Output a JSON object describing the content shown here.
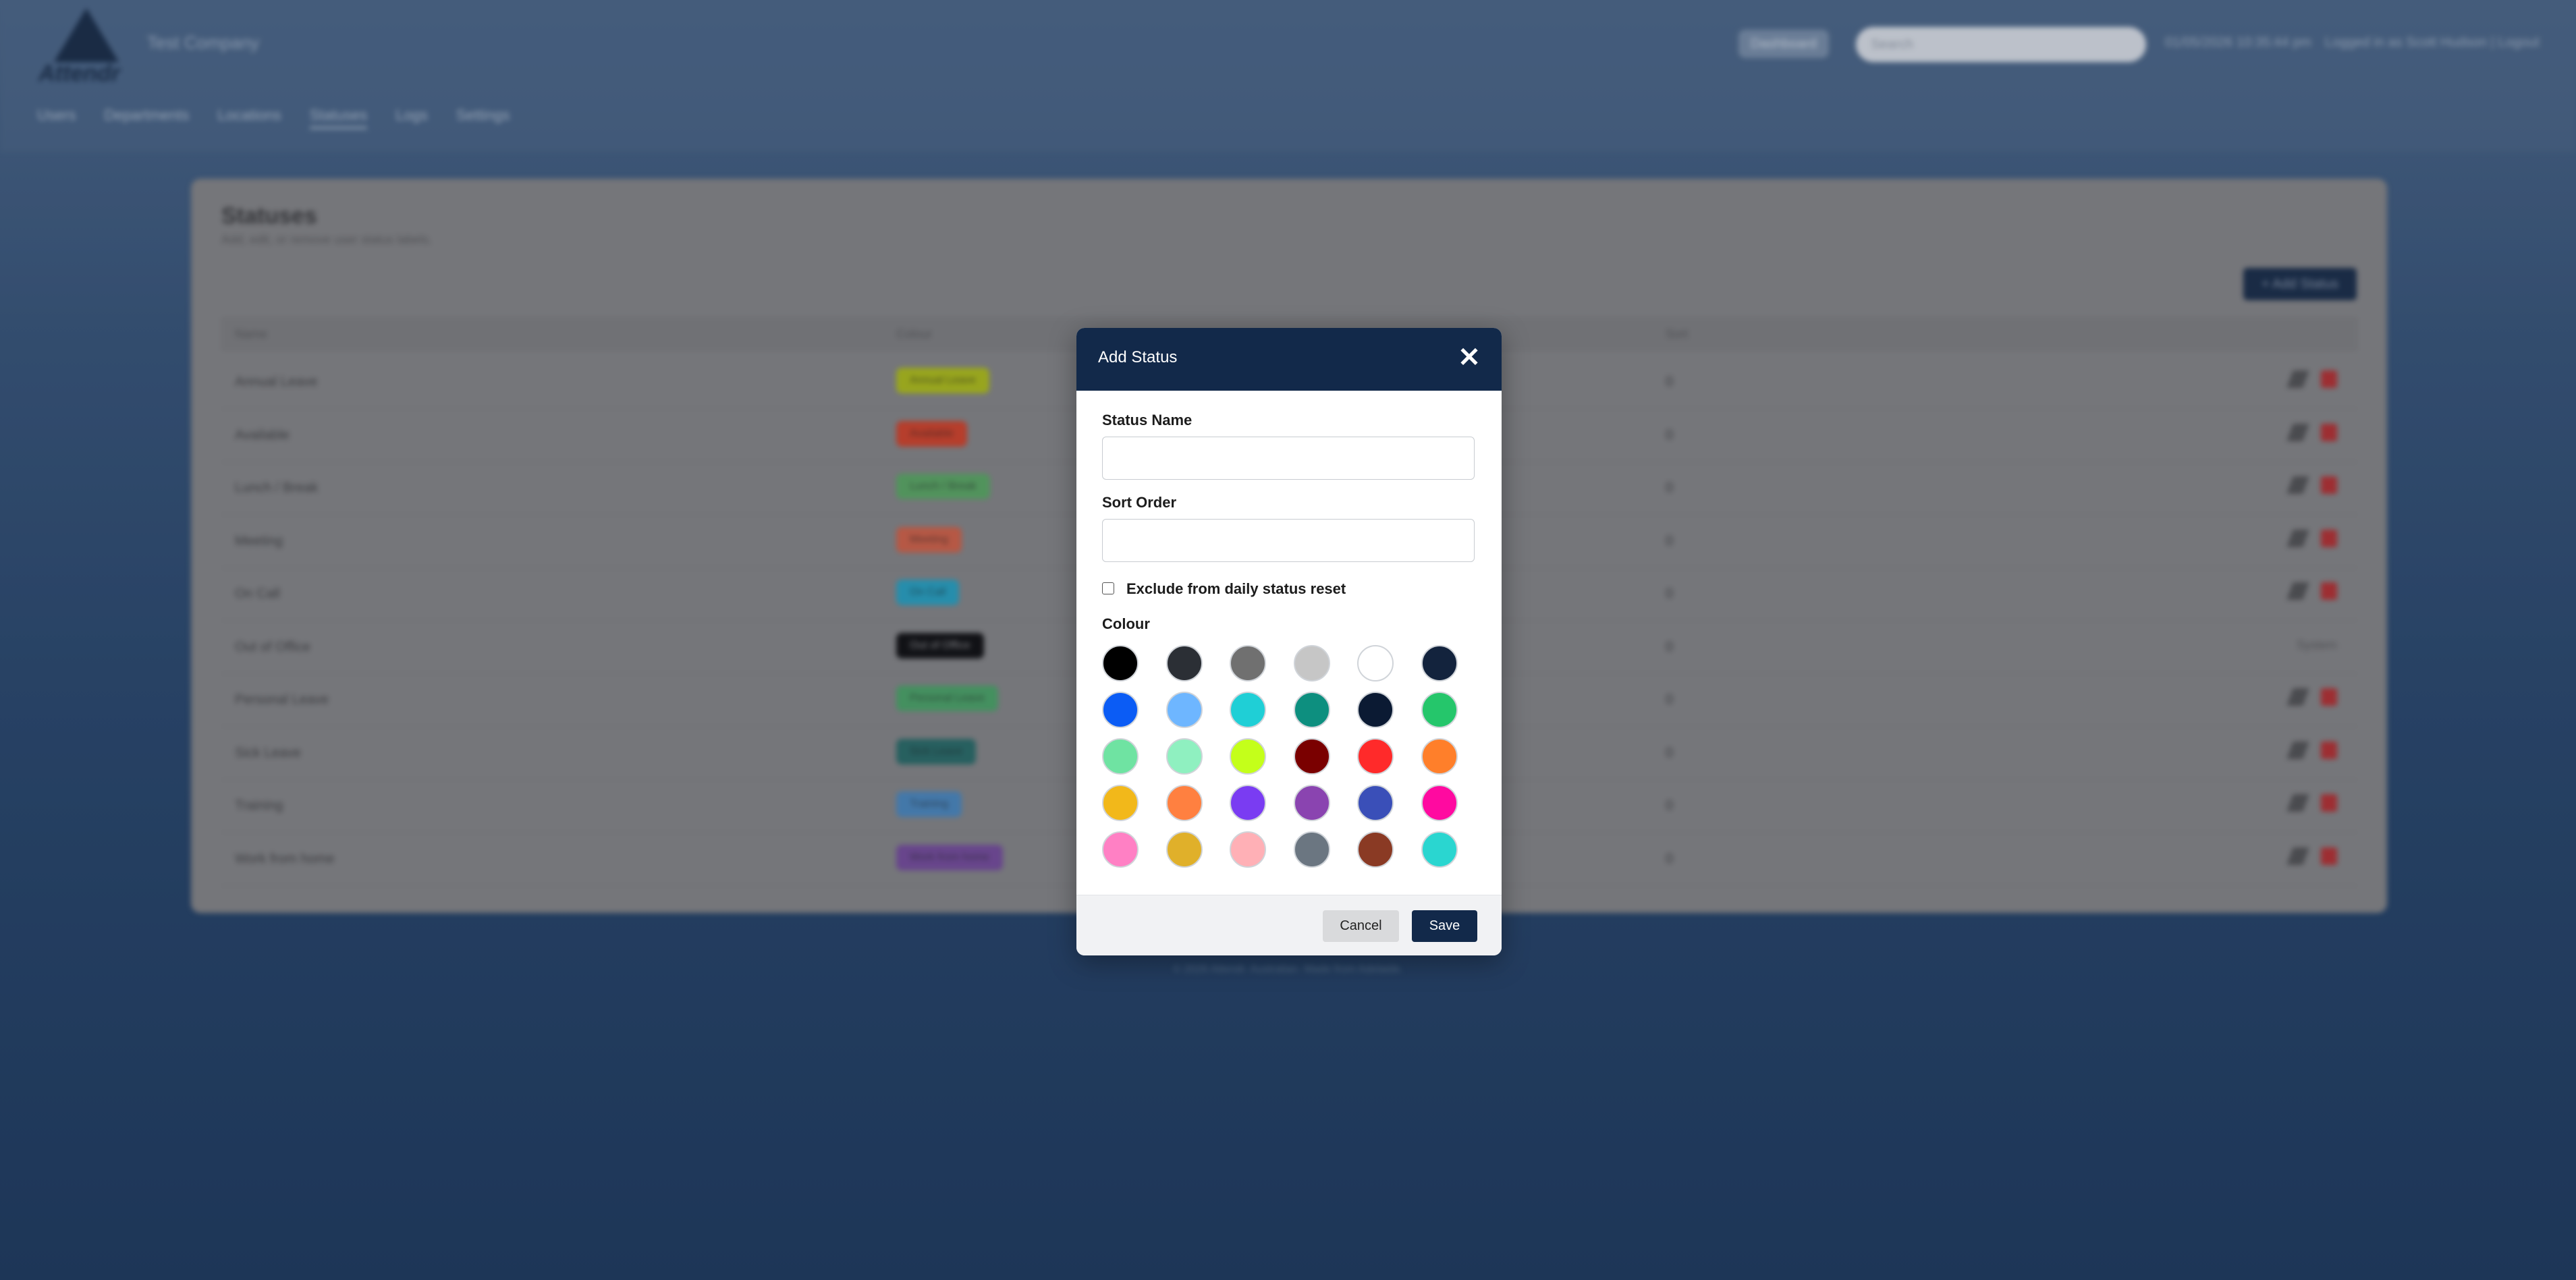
{
  "header": {
    "company": "Test Company",
    "dashboard_label": "Dashboard",
    "search_placeholder": "Search",
    "datetime": "01/05/2026 10:35:44 pm",
    "logged_in": "Logged in as Scott Hudson | Logout",
    "logo_text": "Attendr"
  },
  "nav": [
    "Users",
    "Departments",
    "Locations",
    "Statuses",
    "Logs",
    "Settings"
  ],
  "nav_active": "Statuses",
  "page": {
    "title": "Statuses",
    "subtitle": "Add, edit, or remove user status labels.",
    "add_button": "+ Add Status",
    "columns": [
      "Name",
      "Colour",
      "Sort"
    ],
    "rows": [
      {
        "name": "Annual Leave",
        "badge": "Annual Leave",
        "color": "#b5c41a",
        "sort": "0"
      },
      {
        "name": "Available",
        "badge": "Available",
        "color": "#d9462b",
        "sort": "0"
      },
      {
        "name": "Lunch / Break",
        "badge": "Lunch / Break",
        "color": "#5fae66",
        "sort": "0"
      },
      {
        "name": "Meeting",
        "badge": "Meeting",
        "color": "#d9664a",
        "sort": "0"
      },
      {
        "name": "On Call",
        "badge": "On Call",
        "color": "#2aa7c7",
        "sort": "0"
      },
      {
        "name": "Out of Office",
        "badge": "Out of Office",
        "color": "#111111",
        "sort": "0",
        "system": "System"
      },
      {
        "name": "Personal Leave",
        "badge": "Personal Leave",
        "color": "#4faa6a",
        "sort": "0"
      },
      {
        "name": "Sick Leave",
        "badge": "Sick Leave",
        "color": "#2b6f6a",
        "sort": "0"
      },
      {
        "name": "Training",
        "badge": "Training",
        "color": "#4e8dc4",
        "sort": "0"
      },
      {
        "name": "Work from home",
        "badge": "Work from home",
        "color": "#7a4fa0",
        "sort": "0"
      }
    ],
    "footer": "© 2026 Attendr. Australian. Made from Adelaide."
  },
  "modal": {
    "title": "Add Status",
    "close_symbol": "✕",
    "status_name_label": "Status Name",
    "status_name_value": "",
    "sort_order_label": "Sort Order",
    "sort_order_value": "",
    "exclude_label": "Exclude from daily status reset",
    "exclude_checked": false,
    "colour_label": "Colour",
    "swatches": [
      "#000000",
      "#2b2f35",
      "#707070",
      "#c6c6c6",
      "#ffffff",
      "#13233d",
      "#0b5cf5",
      "#6eb6ff",
      "#1fcfd6",
      "#0d8f7f",
      "#0b1a33",
      "#25c66b",
      "#6fe3a2",
      "#8ff0c0",
      "#c4ff1a",
      "#7a0000",
      "#ff2a2a",
      "#ff7f2a",
      "#f2b81a",
      "#ff8040",
      "#7a3cf2",
      "#8a44b0",
      "#3a4fb8",
      "#ff0aa0",
      "#ff80c4",
      "#e0b02a",
      "#ffb0b6",
      "#6b7681",
      "#8a3a24",
      "#2ad6d0"
    ],
    "cancel_label": "Cancel",
    "save_label": "Save"
  }
}
